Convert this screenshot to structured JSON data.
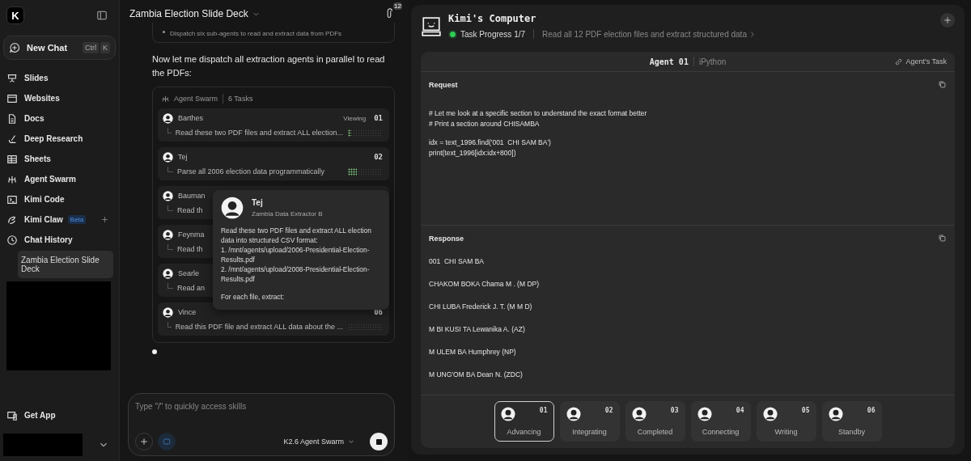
{
  "sidebar": {
    "logo": "K",
    "new_chat": {
      "label": "New Chat",
      "shortcut": [
        "Ctrl",
        "K"
      ]
    },
    "items": [
      {
        "label": "Slides"
      },
      {
        "label": "Websites"
      },
      {
        "label": "Docs"
      },
      {
        "label": "Deep Research"
      },
      {
        "label": "Sheets"
      },
      {
        "label": "Agent Swarm"
      },
      {
        "label": "Kimi Code"
      },
      {
        "label": "Kimi Claw",
        "badge": "Beta",
        "addable": true
      }
    ],
    "history": {
      "label": "Chat History",
      "items": [
        {
          "label": "Zambia Election Slide Deck",
          "selected": true
        }
      ]
    },
    "get_app": "Get App"
  },
  "chat": {
    "title": "Zambia Election Slide Deck",
    "attachments": "12",
    "step": "Dispatch six sub-agents to read and extract data from PDFs",
    "message": "Now let me dispatch all extraction agents in parallel to read the PDFs:",
    "swarm": {
      "title": "Agent Swarm",
      "count": "6 Tasks",
      "tasks": [
        {
          "name": "Barthes",
          "task": "Read these two PDF files and extract ALL election...",
          "badge": "Viewing",
          "number": "01",
          "level": 0.1
        },
        {
          "name": "Tej",
          "task": "Parse all 2006 election data programmatically",
          "number": "02",
          "level": 0.25
        },
        {
          "name": "Bauman",
          "task": "Read th"
        },
        {
          "name": "Feynma",
          "task": "Read th"
        },
        {
          "name": "Searle",
          "task": "Read an"
        },
        {
          "name": "Vince",
          "task": "Read this PDF file and extract ALL data about the ...",
          "number": "06",
          "level": 0
        }
      ]
    },
    "tooltip": {
      "name": "Tej",
      "role": "Zambia Data Extractor B",
      "lines": [
        "Read these two PDF files and extract ALL election data into structured CSV format:",
        "1. /mnt/agents/upload/2006-Presidential-Election-Results.pdf",
        "2. /mnt/agents/upload/2008-Presidential-Election-Results.pdf",
        "For each file, extract:"
      ]
    },
    "input": {
      "placeholder": "Type \"/\" to quickly access skills",
      "model": "K2.6 Agent Swarm"
    }
  },
  "computer": {
    "title": "Kimi's Computer",
    "progress": "Task Progress 1/7",
    "current_task": "Read all 12 PDF election files and extract structured data",
    "agent": "Agent 01",
    "tool": "iPython",
    "agents_task": "Agent's Task",
    "request": {
      "label": "Request",
      "blocks": [
        [
          "# Let me look at a specific section to understand the exact format better",
          "# Print a section around CHISAMBA"
        ],
        [
          "idx = text_1996.find('001  CHI SAM BA')",
          "print(text_1996[idx:idx+800])"
        ]
      ]
    },
    "response": {
      "label": "Response",
      "lines": [
        "001  CHI SAM BA",
        "CHAKOM BOKA Chama M . (M DP)",
        "CHI LUBA Frederick J. T. (M M D)",
        "M BI KUSI TA Lewanika A. (AZ)",
        "M ULEM BA Humphrey (NP)",
        "M UNG'OM BA Dean N. (ZDC)"
      ]
    },
    "agents": [
      {
        "number": "01",
        "status": "Advancing",
        "selected": true
      },
      {
        "number": "02",
        "status": "Integrating",
        "selected": false
      },
      {
        "number": "03",
        "status": "Completed",
        "selected": false
      },
      {
        "number": "04",
        "status": "Connecting",
        "selected": false
      },
      {
        "number": "05",
        "status": "Writing",
        "selected": false
      },
      {
        "number": "06",
        "status": "Standby",
        "selected": false
      }
    ]
  }
}
